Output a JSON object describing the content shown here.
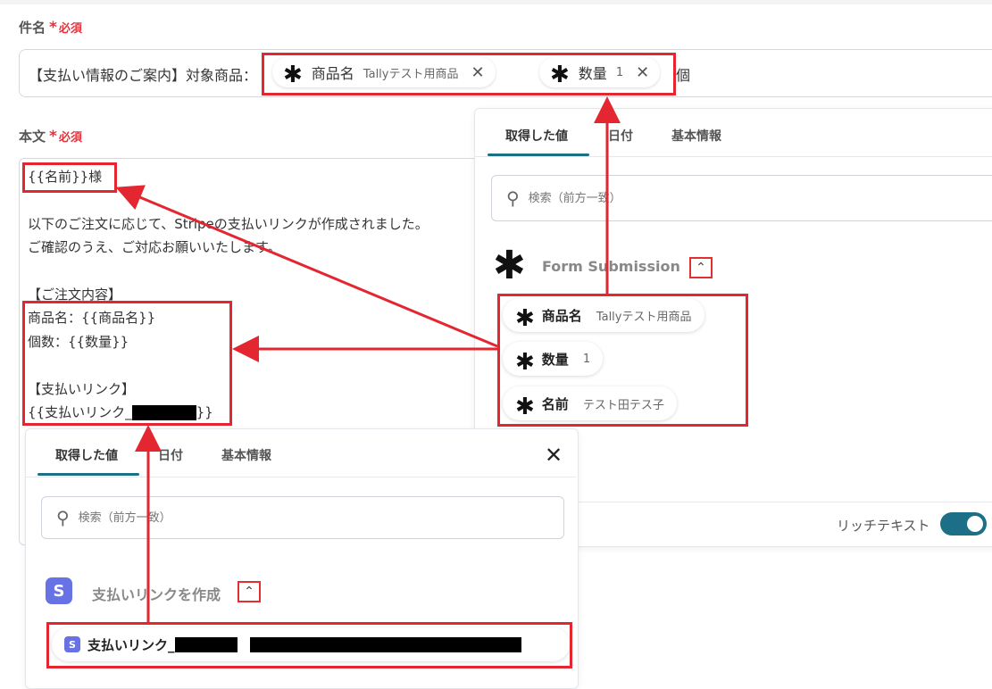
{
  "subject": {
    "label": "件名",
    "required": "必須",
    "prefix_text": "【支払い情報のご案内】対象商品：",
    "chips": [
      {
        "name": "商品名",
        "value": "Tallyテスト用商品"
      },
      {
        "name": "数量",
        "value": "1"
      }
    ],
    "suffix_text": "個"
  },
  "body": {
    "label": "本文",
    "required": "必須",
    "lines": [
      "{{名前}}様",
      "以下のご注文に応じて、Stripeの支払いリンクが作成されました。",
      "ご確認のうえ、ご対応お願いいたします。",
      "【ご注文内容】",
      "商品名：{{商品名}}",
      "個数：{{数量}}",
      "【支払いリンク】",
      "{{支払いリンク_",
      "}}"
    ]
  },
  "right_panel": {
    "tabs": [
      "取得した値",
      "日付",
      "基本情報"
    ],
    "search_placeholder": "検索（前方一致）",
    "group_title": "Form Submission",
    "items": [
      {
        "name": "商品名",
        "value": "Tallyテスト用商品"
      },
      {
        "name": "数量",
        "value": "1"
      },
      {
        "name": "名前",
        "value": "テスト田テス子"
      }
    ],
    "rich_text_label": "リッチテキスト"
  },
  "bottom_panel": {
    "tabs": [
      "取得した値",
      "日付",
      "基本情報"
    ],
    "search_placeholder": "検索（前方一致）",
    "group_title": "支払いリンクを作成",
    "item_name": "支払いリンク_",
    "stripe_letter": "S"
  },
  "icons": {
    "asterisk": "asterisk-icon",
    "search": "search-icon",
    "close": "close-icon",
    "caret_up": "caret-up-icon",
    "stripe": "stripe-icon"
  },
  "colors": {
    "accent": "#1c6f87",
    "annotation_red": "#e3262f",
    "required_red": "#e6323c",
    "stripe": "#6772e5"
  }
}
